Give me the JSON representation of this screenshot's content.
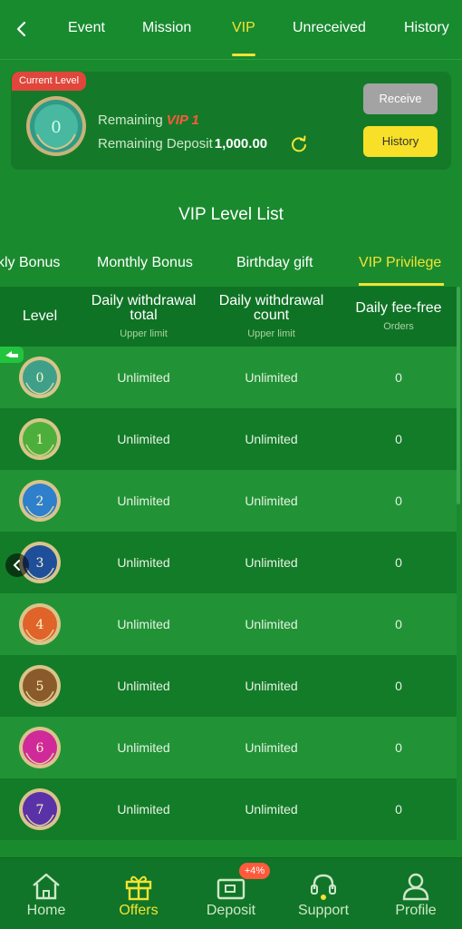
{
  "top_tabs": [
    {
      "label": "Event"
    },
    {
      "label": "Mission"
    },
    {
      "label": "VIP"
    },
    {
      "label": "Unreceived"
    },
    {
      "label": "History"
    }
  ],
  "current": {
    "badge": "Current Level",
    "level_number": "0",
    "remaining_label": "Remaining",
    "remaining_vip": "VIP 1",
    "deposit_label": "Remaining Deposit",
    "deposit_amount": "1,000.00",
    "receive_label": "Receive",
    "history_label": "History"
  },
  "section_title": "VIP Level List",
  "sub_tabs": [
    {
      "label": "kly Bonus"
    },
    {
      "label": "Monthly Bonus"
    },
    {
      "label": "Birthday gift"
    },
    {
      "label": "VIP Privilege"
    }
  ],
  "table": {
    "headers": {
      "level": "Level",
      "withdraw_total_1": "Daily withdrawal",
      "withdraw_total_2": "total",
      "withdraw_total_sub": "Upper limit",
      "withdraw_count_1": "Daily withdrawal",
      "withdraw_count_2": "count",
      "withdraw_count_sub": "Upper limit",
      "fee_free": "Daily fee-free",
      "fee_free_sub": "Orders"
    },
    "rows": [
      {
        "level": "0",
        "total": "Unlimited",
        "count": "Unlimited",
        "fee_free": "0",
        "color": "#3fa08a"
      },
      {
        "level": "1",
        "total": "Unlimited",
        "count": "Unlimited",
        "fee_free": "0",
        "color": "#4caf3c"
      },
      {
        "level": "2",
        "total": "Unlimited",
        "count": "Unlimited",
        "fee_free": "0",
        "color": "#2e7fcc"
      },
      {
        "level": "3",
        "total": "Unlimited",
        "count": "Unlimited",
        "fee_free": "0",
        "color": "#1f4f9a"
      },
      {
        "level": "4",
        "total": "Unlimited",
        "count": "Unlimited",
        "fee_free": "0",
        "color": "#e0642a"
      },
      {
        "level": "5",
        "total": "Unlimited",
        "count": "Unlimited",
        "fee_free": "0",
        "color": "#8b5a2b"
      },
      {
        "level": "6",
        "total": "Unlimited",
        "count": "Unlimited",
        "fee_free": "0",
        "color": "#d02a9a"
      },
      {
        "level": "7",
        "total": "Unlimited",
        "count": "Unlimited",
        "fee_free": "0",
        "color": "#5a32a8"
      }
    ]
  },
  "bottom_nav": [
    {
      "label": "Home",
      "icon": "home-icon"
    },
    {
      "label": "Offers",
      "icon": "gift-icon"
    },
    {
      "label": "Deposit",
      "icon": "wallet-icon"
    },
    {
      "label": "Support",
      "icon": "headset-icon"
    },
    {
      "label": "Profile",
      "icon": "person-icon"
    }
  ],
  "deposit_promo": "+4%",
  "colors": {
    "accent": "#f4e332",
    "background": "#1a8a2e",
    "current_badge": "#e0463b",
    "receive_button": "#a3a3a3",
    "history_button": "#f7e027"
  }
}
